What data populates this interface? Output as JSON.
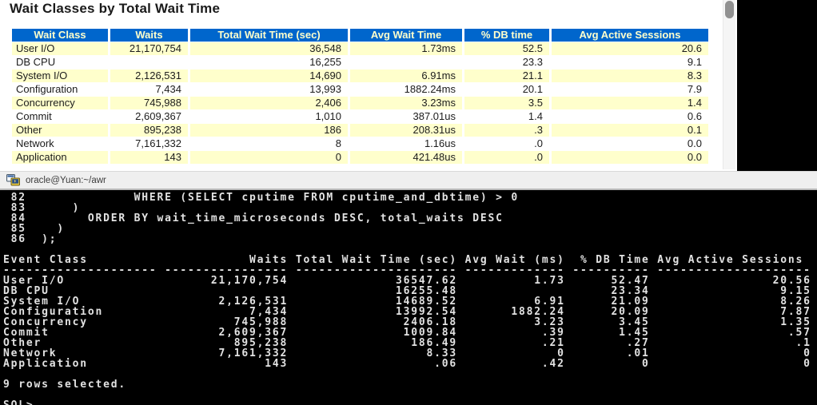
{
  "theme": {
    "header_bg": "#0066cc",
    "header_fg": "#ffffcc",
    "row_alt": "#ffffcc",
    "report_bg": "#ffffff",
    "titlebar_bg": "#efefef",
    "terminal_bg": "#000000",
    "terminal_fg": "#e2e2e2"
  },
  "report": {
    "title": "Wait Classes by Total Wait Time",
    "table": {
      "columns": [
        "Wait Class",
        "Waits",
        "Total Wait Time (sec)",
        "Avg Wait Time",
        "% DB time",
        "Avg Active Sessions"
      ],
      "rows": [
        [
          "User I/O",
          "21,170,754",
          "36,548",
          "1.73ms",
          "52.5",
          "20.6"
        ],
        [
          "DB CPU",
          "",
          "16,255",
          "",
          "23.3",
          "9.1"
        ],
        [
          "System I/O",
          "2,126,531",
          "14,690",
          "6.91ms",
          "21.1",
          "8.3"
        ],
        [
          "Configuration",
          "7,434",
          "13,993",
          "1882.24ms",
          "20.1",
          "7.9"
        ],
        [
          "Concurrency",
          "745,988",
          "2,406",
          "3.23ms",
          "3.5",
          "1.4"
        ],
        [
          "Commit",
          "2,609,367",
          "1,010",
          "387.01us",
          "1.4",
          "0.6"
        ],
        [
          "Other",
          "895,238",
          "186",
          "208.31us",
          ".3",
          "0.1"
        ],
        [
          "Network",
          "7,161,332",
          "8",
          "1.16us",
          ".0",
          "0.0"
        ],
        [
          "Application",
          "143",
          "0",
          "421.48us",
          ".0",
          "0.0"
        ]
      ]
    }
  },
  "terminal": {
    "titlebar": {
      "icon": "terminal-icon",
      "title": "oracle@Yuan:~/awr"
    },
    "lines": [
      " 82              WHERE (SELECT cputime FROM cputime_and_dbtime) > 0",
      " 83      )",
      " 84        ORDER BY wait_time_microseconds DESC, total_waits DESC",
      " 85    )",
      " 86  );",
      "",
      "Event Class                     Waits Total Wait Time (sec) Avg Wait (ms)  % DB Time Avg Active Sessions",
      "-------------------- ---------------- --------------------- ------------- ---------- --------------------",
      "User I/O                   21,170,754              36547.62          1.73      52.47                20.56",
      "DB CPU                                             16255.48                    23.34                 9.15",
      "System I/O                  2,126,531              14689.52          6.91      21.09                 8.26",
      "Configuration                   7,434              13992.54       1882.24      20.09                 7.87",
      "Concurrency                   745,988               2406.18          3.23       3.45                 1.35",
      "Commit                      2,609,367               1009.84           .39       1.45                  .57",
      "Other                         895,238                186.49           .21        .27                   .1",
      "Network                     7,161,332                  8.33             0        .01                    0",
      "Application                       143                   .06           .42          0                    0",
      "",
      "9 rows selected.",
      "",
      "SQL>"
    ]
  }
}
